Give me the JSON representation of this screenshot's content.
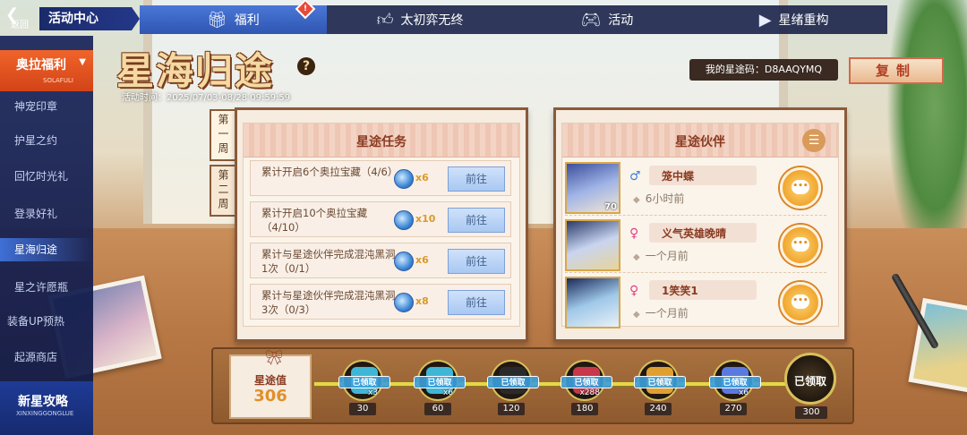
{
  "topbar": {
    "back_label": "返回",
    "title": "活动中心",
    "tabs": [
      {
        "label": "福利",
        "icon": "gift-icon",
        "active": true,
        "badge": "!"
      },
      {
        "label": "太初弈无终",
        "icon": "thumbs-up-icon",
        "active": false
      },
      {
        "label": "活动",
        "icon": "gamepad-icon",
        "active": false
      },
      {
        "label": "星绪重构",
        "icon": "video-icon",
        "active": false
      }
    ]
  },
  "sidebar": {
    "header": {
      "label": "奥拉福利",
      "sub": "SOLAFULI"
    },
    "items": [
      {
        "label": "神宠印章",
        "active": false
      },
      {
        "label": "护星之约",
        "active": false
      },
      {
        "label": "回忆时光礼",
        "active": false
      },
      {
        "label": "登录好礼",
        "active": false
      },
      {
        "label": "星海归途",
        "active": true
      },
      {
        "label": "星之许愿瓶",
        "active": false
      },
      {
        "label": "装备UP预热",
        "active": false
      },
      {
        "label": "起源商店",
        "active": false
      }
    ],
    "footer": {
      "title": "新星攻略",
      "sub": "XINXINGGONGLUE"
    }
  },
  "event": {
    "title": "星海归途",
    "time": "活动时间：2025/07/03-08/28 09:59:59",
    "code_text": "我的星途码：D8AAQYMQ",
    "copy_label": "复制"
  },
  "weeks": [
    {
      "label": "第一周",
      "active": true
    },
    {
      "label": "第二周",
      "active": false
    }
  ],
  "tasks_panel": {
    "title": "星途任务",
    "tasks": [
      {
        "text": "累计开启6个奥拉宝藏（4/6）",
        "reward_qty": "x6",
        "button": "前往"
      },
      {
        "text": "累计开启10个奥拉宝藏（4/10）",
        "reward_qty": "x10",
        "button": "前往"
      },
      {
        "text": "累计与星途伙伴完成混沌黑洞1次（0/1）",
        "reward_qty": "x6",
        "button": "前往"
      },
      {
        "text": "累计与星途伙伴完成混沌黑洞3次（0/3）",
        "reward_qty": "x8",
        "button": "前往"
      }
    ]
  },
  "partners_panel": {
    "title": "星途伙伴",
    "partners": [
      {
        "name": "笼中蝶",
        "gender": "♂",
        "gender_color": "#3f7fe0",
        "time": "6小时前",
        "level": "70"
      },
      {
        "name": "义气英雄晚晴",
        "gender": "♀",
        "gender_color": "#e0408a",
        "time": "一个月前",
        "level": ""
      },
      {
        "name": "1笑笑1",
        "gender": "♀",
        "gender_color": "#e0408a",
        "time": "一个月前",
        "level": ""
      }
    ]
  },
  "progress": {
    "label": "星途值",
    "value": "306",
    "milestones": [
      {
        "mark": "30",
        "stamp": "已领取",
        "qty": "x3",
        "color": "#3fb6d6"
      },
      {
        "mark": "60",
        "stamp": "已领取",
        "qty": "x6",
        "color": "#3fb6d6"
      },
      {
        "mark": "120",
        "stamp": "已领取",
        "qty": "",
        "color": "#2a2a2a"
      },
      {
        "mark": "180",
        "stamp": "已领取",
        "qty": "x288",
        "color": "#c8384a"
      },
      {
        "mark": "240",
        "stamp": "已领取",
        "qty": "",
        "color": "#e0a030"
      },
      {
        "mark": "270",
        "stamp": "已领取",
        "qty": "x6",
        "color": "#5a7ae0"
      },
      {
        "mark": "300",
        "stamp": "已领取",
        "qty": "",
        "color": "#2a2a2a"
      }
    ]
  }
}
